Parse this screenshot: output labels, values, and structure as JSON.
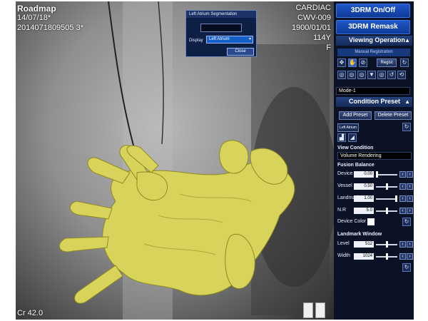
{
  "viewer": {
    "mode": "Roadmap",
    "date": "14/07/18*",
    "study_id": "2014071809505 3*",
    "right_lines": [
      "CARDIAC",
      "CWV-009",
      "1900/01/01",
      "114Y",
      "F"
    ],
    "angle": "Cr 42.0"
  },
  "dialog": {
    "title": "Left Atrium Segmentation",
    "display_label": "Display",
    "display_value": "Left Atrium",
    "close_label": "Close"
  },
  "panel": {
    "btn_3drm": "3DRM On/Off",
    "btn_remask": "3DRM Remask",
    "viewing_operation": "Viewing Operation",
    "manual_registration": "Manual Registration",
    "regist_label": "Regist",
    "mode_value": "Mode-1",
    "condition_preset": "Condition Preset",
    "add_preset": "Add Preset",
    "delete_preset": "Delete Preset",
    "preset_name": "Left Atrium",
    "view_condition": "View Condition",
    "view_condition_value": "Volume Rendering",
    "fusion_balance": "Fusion Balance",
    "fusion_rows": [
      {
        "label": "Device",
        "value": "0.00",
        "level": 0.0
      },
      {
        "label": "Vessel",
        "value": "0.50",
        "level": 0.5
      },
      {
        "label": "Landmark",
        "value": "1.00",
        "level": 1.0
      },
      {
        "label": "N.R",
        "value": "5.0",
        "level": 0.5
      }
    ],
    "device_color": "Device Color",
    "landmark_window": "Landmark Window",
    "window_rows": [
      {
        "label": "Level",
        "value": "512",
        "level": 0.5
      },
      {
        "label": "Width",
        "value": "1024",
        "level": 0.5
      }
    ]
  },
  "colors": {
    "accent": "#1f58c8",
    "panel_bg": "#0b1226",
    "volume": "#d8d35a"
  },
  "icons": [
    "arrow-cross-icon",
    "hand-icon",
    "circle-slash-icon",
    "undo-icon",
    "bar-chart-icon",
    "triangle-chart-icon"
  ]
}
